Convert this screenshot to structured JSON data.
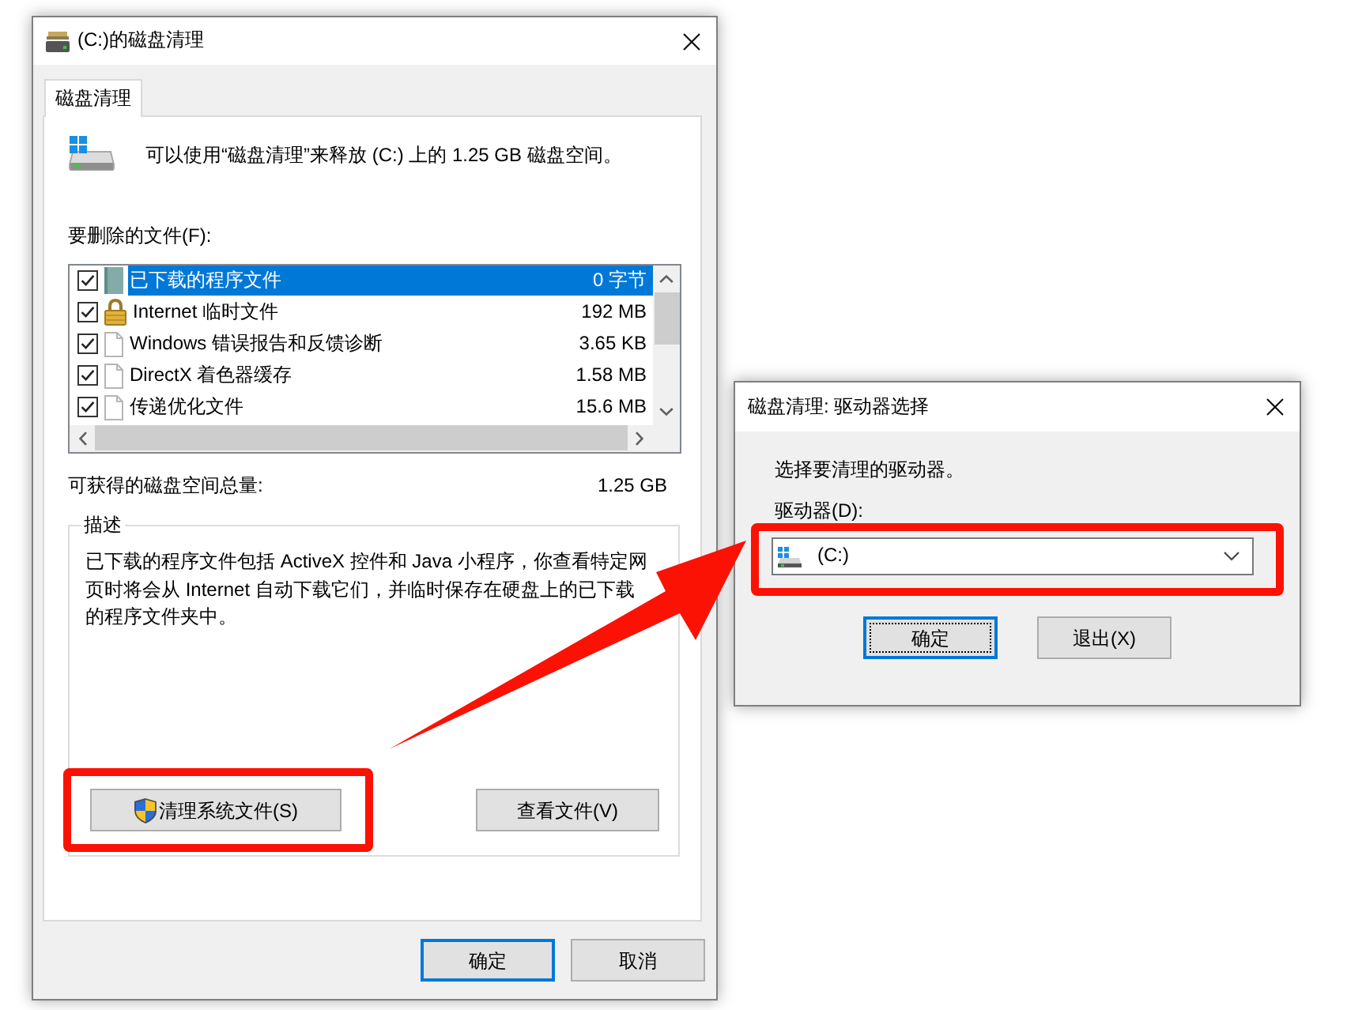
{
  "main_window": {
    "title": "(C:)的磁盘清理",
    "tabs": [
      {
        "label": "磁盘清理",
        "selected": true
      }
    ],
    "summary": "可以使用“磁盘清理”来释放 (C:) 上的 1.25 GB 磁盘空间。",
    "files_label": "要删除的文件(F):",
    "files": [
      {
        "kind": "package",
        "name": "已下载的程序文件",
        "size": "0 字节",
        "checked": true,
        "selected": true
      },
      {
        "kind": "locked",
        "name": "Internet 临时文件",
        "size": "192 MB",
        "checked": true,
        "selected": false
      },
      {
        "kind": "document",
        "name": "Windows 错误报告和反馈诊断",
        "size": "3.65 KB",
        "checked": true,
        "selected": false
      },
      {
        "kind": "document",
        "name": "DirectX 着色器缓存",
        "size": "1.58 MB",
        "checked": true,
        "selected": false
      },
      {
        "kind": "document",
        "name": "传递优化文件",
        "size": "15.6 MB",
        "checked": true,
        "selected": false
      }
    ],
    "total_label": "可获得的磁盘空间总量:",
    "total_value": "1.25 GB",
    "description": {
      "legend": "描述",
      "text": "已下载的程序文件包括 ActiveX 控件和 Java 小程序，你查看特定网页时将会从 Internet 自动下载它们，并临时保存在硬盘上的已下载的程序文件夹中。"
    },
    "buttons": [
      {
        "kind": "elevated",
        "label": "清理系统文件(S)",
        "highlighted": true
      },
      {
        "kind": "normal",
        "label": "查看文件(V)",
        "highlighted": false
      }
    ],
    "footer_buttons": [
      {
        "label": "确定",
        "default": true
      },
      {
        "label": "取消",
        "default": false
      }
    ]
  },
  "drive_dialog": {
    "title": "磁盘清理: 驱动器选择",
    "prompt": "选择要清理的驱动器。",
    "drive_label": "驱动器(D):",
    "drive_select": {
      "value": "(C:)",
      "highlighted": true
    },
    "buttons": [
      {
        "label": "确定",
        "focused": true
      },
      {
        "label": "退出(X)",
        "focused": false
      }
    ]
  },
  "arrow_annotation": true
}
